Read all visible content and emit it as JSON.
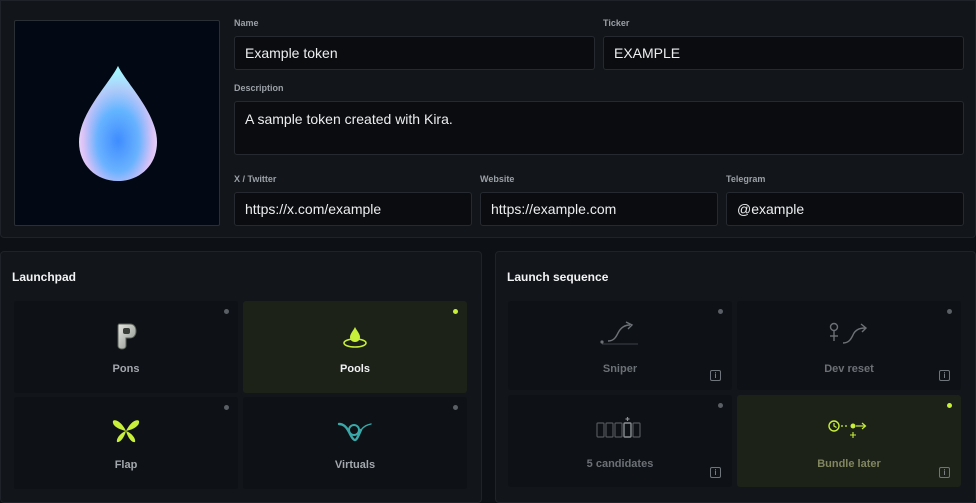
{
  "token": {
    "name_label": "Name",
    "name_value": "Example token",
    "ticker_label": "Ticker",
    "ticker_value": "EXAMPLE",
    "description_label": "Description",
    "description_value": "A sample token created with Kira.",
    "twitter_label": "X / Twitter",
    "twitter_value": "https://x.com/example",
    "website_label": "Website",
    "website_value": "https://example.com",
    "telegram_label": "Telegram",
    "telegram_value": "@example",
    "image_icon": "droplet-icon"
  },
  "launchpad": {
    "title": "Launchpad",
    "options": [
      {
        "label": "Pons",
        "icon": "pons-logo-icon",
        "selected": false
      },
      {
        "label": "Pools",
        "icon": "pools-logo-icon",
        "selected": true
      },
      {
        "label": "Flap",
        "icon": "flap-logo-icon",
        "selected": false
      },
      {
        "label": "Virtuals",
        "icon": "virtuals-logo-icon",
        "selected": false
      }
    ]
  },
  "sequence": {
    "title": "Launch sequence",
    "options": [
      {
        "label": "Sniper",
        "icon": "sniper-curve-icon",
        "selected": false
      },
      {
        "label": "Dev reset",
        "icon": "dev-reset-icon",
        "selected": false
      },
      {
        "label": "5 candidates",
        "icon": "candidates-icon",
        "selected": false
      },
      {
        "label": "Bundle later",
        "icon": "bundle-later-icon",
        "selected": true
      }
    ],
    "info_glyph": "i"
  },
  "colors": {
    "accent": "#c8ef3a",
    "background": "#0d1014",
    "panel": "#121519",
    "selected_card": "#1d2219"
  }
}
